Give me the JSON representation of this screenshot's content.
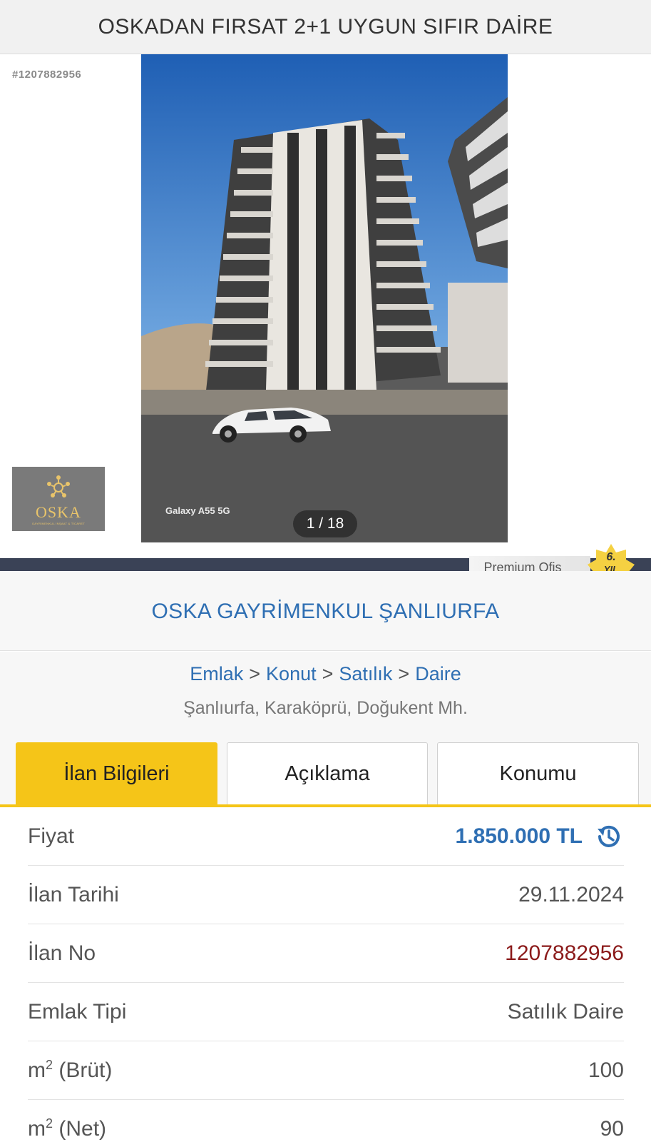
{
  "header": {
    "title": "OSKADAN FIRSAT 2+1 UYGUN SIFIR DAİRE"
  },
  "gallery": {
    "listing_id": "#1207882956",
    "counter": "1 / 18",
    "camera_label": "Galaxy A55 5G",
    "logo_text": "OSKA",
    "logo_subtext": "GAYRİMENKUL İNŞAAT & TİCARET"
  },
  "premium": {
    "label": "Premium Ofis",
    "year_badge_line1": "6.",
    "year_badge_line2": "YIL",
    "badge_color": "#f5d142"
  },
  "store": {
    "name": "OSKA GAYRİMENKUL ŞANLIURFA"
  },
  "breadcrumb": {
    "items": [
      "Emlak",
      "Konut",
      "Satılık",
      "Daire"
    ],
    "separator": ">",
    "location": "Şanlıurfa, Karaköprü, Doğukent Mh."
  },
  "tabs": [
    {
      "label": "İlan Bilgileri",
      "active": true
    },
    {
      "label": "Açıklama",
      "active": false
    },
    {
      "label": "Konumu",
      "active": false
    }
  ],
  "info": {
    "price_label": "Fiyat",
    "price_value": "1.850.000 TL",
    "date_label": "İlan Tarihi",
    "date_value": "29.11.2024",
    "no_label": "İlan No",
    "no_value": "1207882956",
    "type_label": "Emlak Tipi",
    "type_value": "Satılık Daire",
    "gross_label": "(Brüt)",
    "gross_value": "100",
    "net_label": "(Net)",
    "net_value": "90",
    "m_label": "m",
    "sq_label": "2"
  },
  "colors": {
    "accent_yellow": "#f5c518",
    "link_blue": "#2f6fb3",
    "id_red": "#8b1a1a",
    "band_navy": "#3a4256"
  }
}
